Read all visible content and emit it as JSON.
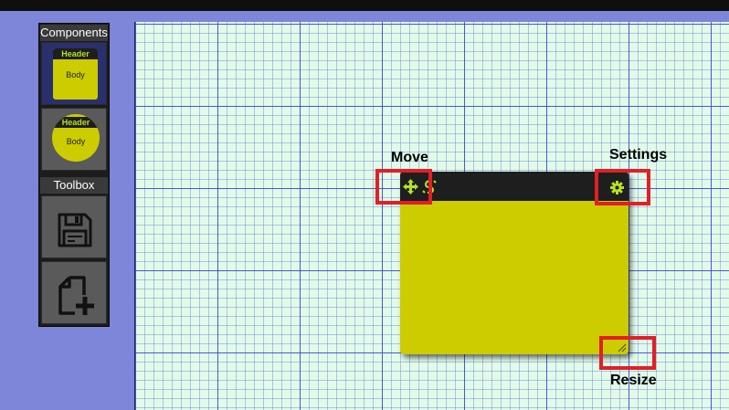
{
  "palette": {
    "components_label": "Components",
    "toolbox_label": "Toolbox",
    "components": [
      {
        "shape": "rectangle",
        "header": "Header",
        "body": "Body",
        "selected": true
      },
      {
        "shape": "circle",
        "header": "Header",
        "body": "Body",
        "selected": false
      }
    ],
    "tools": [
      {
        "icon": "floppy-disk-icon"
      },
      {
        "icon": "new-document-plus-icon"
      }
    ]
  },
  "widget": {
    "color": "#cccc00",
    "header_color": "#1e1e1e",
    "accent_color": "#b6e21f"
  },
  "annotations": {
    "move": "Move",
    "settings": "Settings",
    "resize": "Resize",
    "highlight_color": "#e21f26"
  }
}
